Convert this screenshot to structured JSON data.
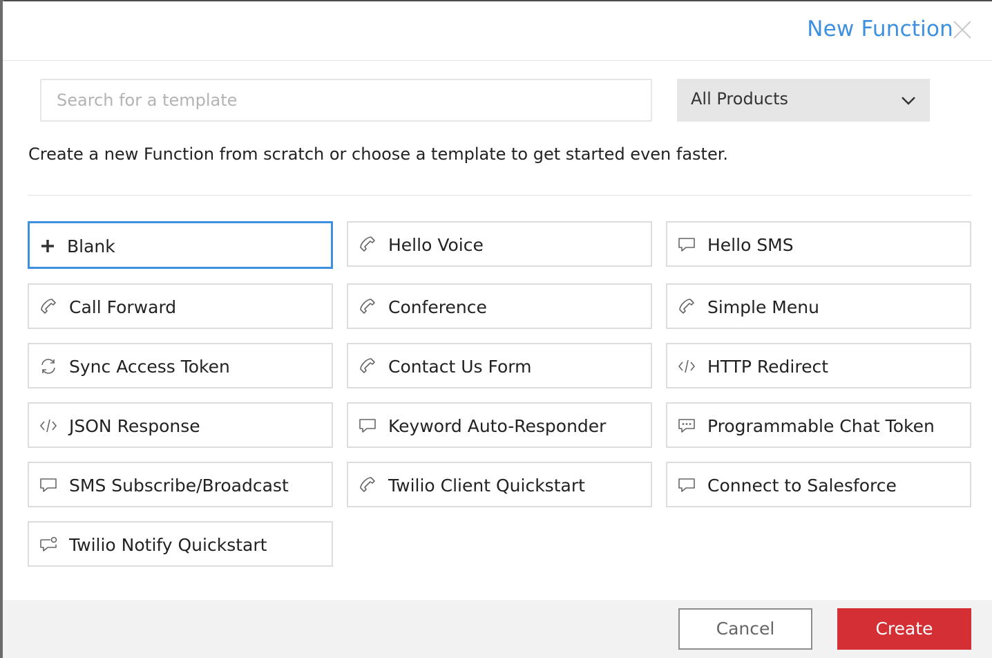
{
  "modal": {
    "title": "New Function",
    "close_icon": "close-icon"
  },
  "search": {
    "placeholder": "Search for a template",
    "value": ""
  },
  "product_filter": {
    "selected": "All Products",
    "icon": "chevron-down-icon"
  },
  "intro": "Create a new Function from scratch or choose a template to get started even faster.",
  "templates": [
    {
      "label": "Blank",
      "icon": "plus-icon",
      "selected": true
    },
    {
      "label": "Hello Voice",
      "icon": "phone-icon"
    },
    {
      "label": "Hello SMS",
      "icon": "sms-icon"
    },
    {
      "label": "Call Forward",
      "icon": "phone-icon"
    },
    {
      "label": "Conference",
      "icon": "phone-icon"
    },
    {
      "label": "Simple Menu",
      "icon": "phone-icon"
    },
    {
      "label": "Sync Access Token",
      "icon": "sync-icon"
    },
    {
      "label": "Contact Us Form",
      "icon": "phone-icon"
    },
    {
      "label": "HTTP Redirect",
      "icon": "code-icon"
    },
    {
      "label": "JSON Response",
      "icon": "code-icon"
    },
    {
      "label": "Keyword Auto-Responder",
      "icon": "sms-icon"
    },
    {
      "label": "Programmable Chat Token",
      "icon": "chat-icon"
    },
    {
      "label": "SMS Subscribe/Broadcast",
      "icon": "sms-icon"
    },
    {
      "label": "Twilio Client Quickstart",
      "icon": "phone-icon"
    },
    {
      "label": "Connect to Salesforce",
      "icon": "sms-icon"
    },
    {
      "label": "Twilio Notify Quickstart",
      "icon": "notify-icon"
    }
  ],
  "footer": {
    "cancel_label": "Cancel",
    "create_label": "Create"
  },
  "colors": {
    "accent": "#3d8fe0",
    "primary_button": "#d32f34"
  }
}
